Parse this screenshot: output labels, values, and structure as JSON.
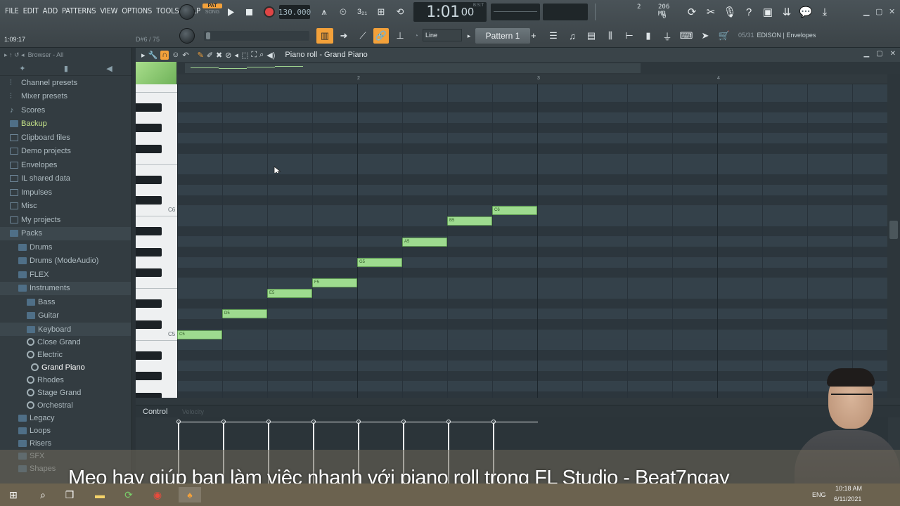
{
  "menu": [
    "FILE",
    "EDIT",
    "ADD",
    "PATTERNS",
    "VIEW",
    "OPTIONS",
    "TOOLS",
    "HELP"
  ],
  "transport": {
    "pat_label": "PAT",
    "song_label": "SONG",
    "tempo": "130.000",
    "time": "1:01",
    "time_ticks": "00",
    "time_unit": "B:S:T",
    "cpu_num": "2",
    "memory": "206 MB",
    "polyphony": "0"
  },
  "hint": {
    "time": "1:09:17",
    "note": "D#6 / 75"
  },
  "toolbar2": {
    "snap": "Line",
    "pattern": "Pattern 1",
    "plugin_index": "05/31",
    "plugin_name": "EDISON | Envelopes"
  },
  "browser": {
    "header": "Browser - All",
    "items": [
      {
        "label": "Channel presets",
        "indent": 0,
        "icon": "preset"
      },
      {
        "label": "Mixer presets",
        "indent": 0,
        "icon": "preset"
      },
      {
        "label": "Scores",
        "indent": 0,
        "icon": "note"
      },
      {
        "label": "Backup",
        "indent": 0,
        "icon": "folder"
      },
      {
        "label": "Clipboard files",
        "indent": 0,
        "icon": "folder-outline"
      },
      {
        "label": "Demo projects",
        "indent": 0,
        "icon": "folder-outline"
      },
      {
        "label": "Envelopes",
        "indent": 0,
        "icon": "folder-outline"
      },
      {
        "label": "IL shared data",
        "indent": 0,
        "icon": "folder-outline"
      },
      {
        "label": "Impulses",
        "indent": 0,
        "icon": "folder-outline"
      },
      {
        "label": "Misc",
        "indent": 0,
        "icon": "folder-outline"
      },
      {
        "label": "My projects",
        "indent": 0,
        "icon": "folder-outline"
      },
      {
        "label": "Packs",
        "indent": 0,
        "icon": "folder"
      },
      {
        "label": "Drums",
        "indent": 1,
        "icon": "folder"
      },
      {
        "label": "Drums (ModeAudio)",
        "indent": 1,
        "icon": "folder"
      },
      {
        "label": "FLEX",
        "indent": 1,
        "icon": "folder"
      },
      {
        "label": "Instruments",
        "indent": 1,
        "icon": "folder"
      },
      {
        "label": "Bass",
        "indent": 2,
        "icon": "folder"
      },
      {
        "label": "Guitar",
        "indent": 2,
        "icon": "folder"
      },
      {
        "label": "Keyboard",
        "indent": 2,
        "icon": "folder"
      },
      {
        "label": "Close Grand",
        "indent": 2,
        "icon": "gear"
      },
      {
        "label": "Electric",
        "indent": 2,
        "icon": "gear"
      },
      {
        "label": "Grand Piano",
        "indent": 3,
        "icon": "gear"
      },
      {
        "label": "Rhodes",
        "indent": 2,
        "icon": "gear"
      },
      {
        "label": "Stage Grand",
        "indent": 2,
        "icon": "gear"
      },
      {
        "label": "Orchestral",
        "indent": 2,
        "icon": "gear"
      },
      {
        "label": "Legacy",
        "indent": 1,
        "icon": "folder"
      },
      {
        "label": "Loops",
        "indent": 1,
        "icon": "folder"
      },
      {
        "label": "Risers",
        "indent": 1,
        "icon": "folder"
      },
      {
        "label": "SFX",
        "indent": 1,
        "icon": "folder"
      },
      {
        "label": "Shapes",
        "indent": 1,
        "icon": "folder"
      }
    ]
  },
  "piano_roll": {
    "title": "Piano roll - Grand Piano",
    "bars": [
      "2",
      "3",
      "4"
    ],
    "key_labels": [
      "C6",
      "C5"
    ],
    "notes": [
      {
        "name": "C5",
        "pitch": 60,
        "start": 0,
        "length": 1
      },
      {
        "name": "D5",
        "pitch": 62,
        "start": 1,
        "length": 1
      },
      {
        "name": "E5",
        "pitch": 64,
        "start": 2,
        "length": 1
      },
      {
        "name": "F5",
        "pitch": 65,
        "start": 3,
        "length": 1
      },
      {
        "name": "G5",
        "pitch": 67,
        "start": 4,
        "length": 1
      },
      {
        "name": "A5",
        "pitch": 69,
        "start": 5,
        "length": 1
      },
      {
        "name": "B5",
        "pitch": 71,
        "start": 6,
        "length": 1
      },
      {
        "name": "C6",
        "pitch": 72,
        "start": 7,
        "length": 1
      }
    ]
  },
  "control": {
    "label": "Control",
    "param": "Velocity"
  },
  "caption": "Meo hay giúp bạn làm việc nhanh với piano roll trong FL Studio - Beat7ngay",
  "taskbar": {
    "lang": "ENG",
    "time": "10:18 AM",
    "date": "6/11/2021"
  },
  "colors": {
    "note_fill": "#9edb8f",
    "accent": "#f3a13a",
    "record": "#e04545"
  }
}
